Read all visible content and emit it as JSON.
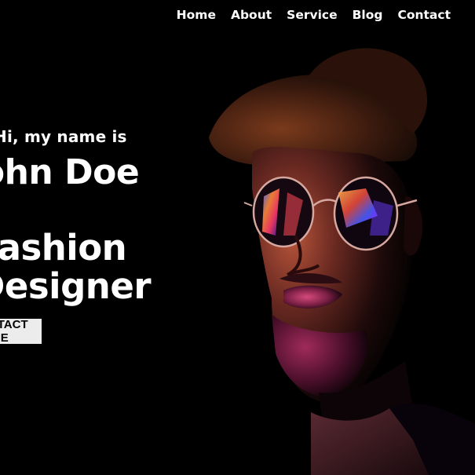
{
  "nav": {
    "items": [
      {
        "label": "Home"
      },
      {
        "label": "About"
      },
      {
        "label": "Service"
      },
      {
        "label": "Blog"
      },
      {
        "label": "Contact"
      }
    ]
  },
  "hero": {
    "greeting": "Hi, my name is",
    "name": "John Doe",
    "role_line1": "Fashion",
    "role_line2": "Designer",
    "cta_label": "CONTACT ME"
  },
  "colors": {
    "background": "#000000",
    "text": "#ffffff",
    "button_bg": "#ececec",
    "button_text": "#000000",
    "photo_warm_glow": "#e0642a",
    "photo_pink_glow": "#c2306a"
  }
}
